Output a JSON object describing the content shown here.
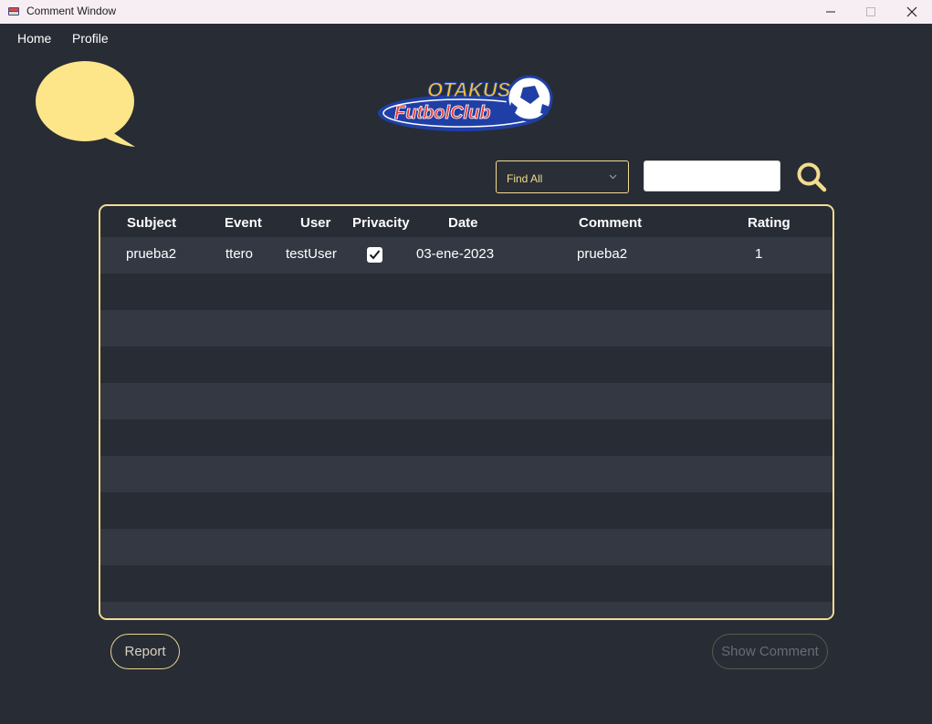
{
  "window": {
    "title": "Comment Window"
  },
  "menu": {
    "home": "Home",
    "profile": "Profile"
  },
  "logo": {
    "line1": "OTAKUS",
    "line2": "FutbolClub"
  },
  "filter": {
    "selected": "Find All"
  },
  "search": {
    "value": "",
    "placeholder": ""
  },
  "table": {
    "headers": {
      "subject": "Subject",
      "event": "Event",
      "user": "User",
      "privacy": "Privacity",
      "date": "Date",
      "comment": "Comment",
      "rating": "Rating"
    },
    "rows": [
      {
        "subject": "prueba2",
        "event": "ttero",
        "user": "testUser",
        "privacy": true,
        "date": "03-ene-2023",
        "comment": "prueba2",
        "rating": "1"
      }
    ]
  },
  "buttons": {
    "report": "Report",
    "show_comment": "Show Comment"
  },
  "colors": {
    "accent": "#f3dc8f",
    "background": "#282c35",
    "row_alt": "#333843",
    "bubble": "#fde68a"
  },
  "icons": {
    "bubble": "speech-bubble-icon",
    "search": "search-icon",
    "dropdown": "chevron-down-icon",
    "check": "check-icon"
  }
}
